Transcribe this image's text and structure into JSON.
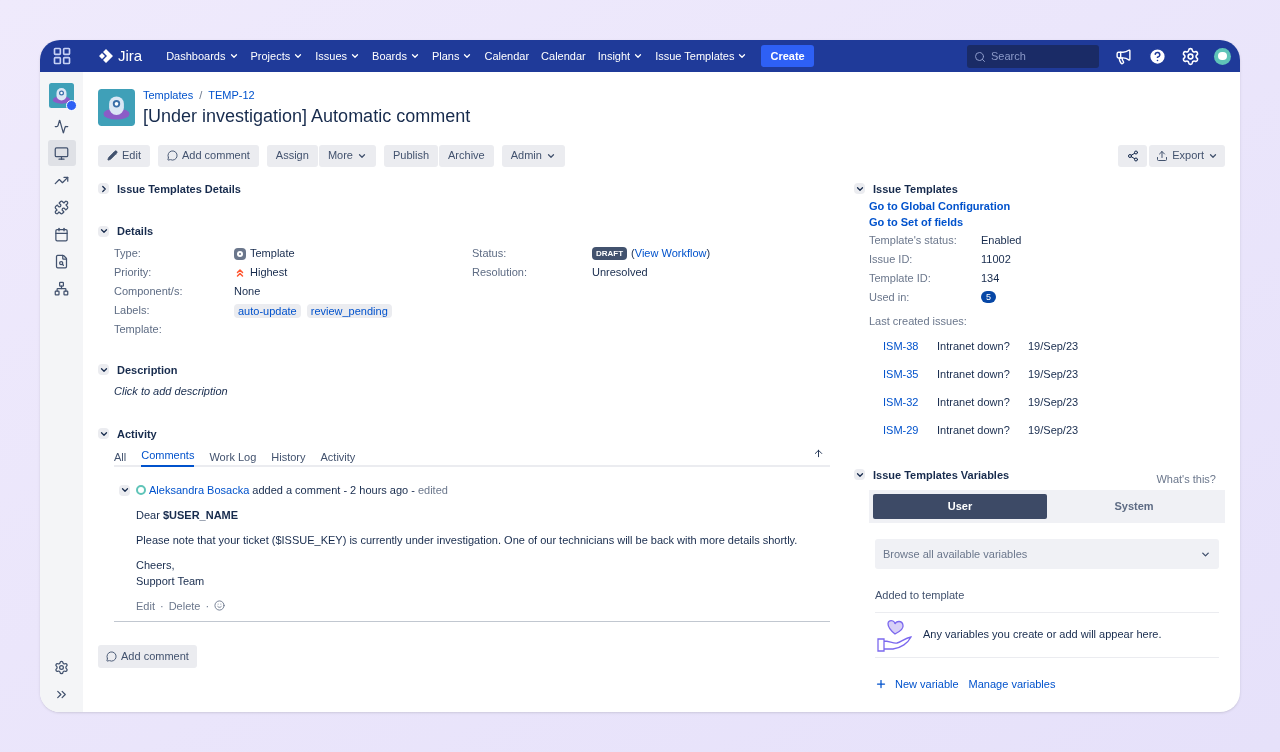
{
  "nav": {
    "logo": "Jira",
    "items": [
      {
        "label": "Dashboards",
        "has_menu": true
      },
      {
        "label": "Projects",
        "has_menu": true
      },
      {
        "label": "Issues",
        "has_menu": true
      },
      {
        "label": "Boards",
        "has_menu": true
      },
      {
        "label": "Plans",
        "has_menu": true
      },
      {
        "label": "Calendar",
        "has_menu": false
      },
      {
        "label": "Calendar",
        "has_menu": false
      },
      {
        "label": "Insight",
        "has_menu": true
      },
      {
        "label": "Issue Templates",
        "has_menu": true
      }
    ],
    "create": "Create",
    "search": {
      "placeholder": "Search"
    }
  },
  "sidebar": {
    "items": [
      {
        "selected": false
      },
      {
        "selected": true
      },
      {
        "selected": false
      },
      {
        "selected": false
      },
      {
        "selected": false
      },
      {
        "selected": false
      },
      {
        "selected": false
      }
    ]
  },
  "breadcrumbs": [
    {
      "label": "Templates",
      "kind": "link"
    },
    {
      "label": "/",
      "kind": "separator"
    },
    {
      "label": "TEMP-12",
      "kind": "link"
    }
  ],
  "title": "[Under investigation] Automatic comment",
  "toolbar": [
    [
      {
        "label": "Edit",
        "kind": "edit",
        "has_menu": false
      }
    ],
    [
      {
        "label": "Add comment",
        "kind": "comment",
        "has_menu": false
      }
    ],
    [
      {
        "label": "Assign",
        "kind": "plain",
        "has_menu": false
      },
      {
        "label": "More",
        "kind": "plain",
        "has_menu": true
      }
    ],
    [
      {
        "label": "Publish",
        "kind": "plain",
        "has_menu": false
      },
      {
        "label": "Archive",
        "kind": "plain",
        "has_menu": false
      }
    ],
    [
      {
        "label": "Admin",
        "kind": "plain",
        "has_menu": true
      }
    ]
  ],
  "export": "Export",
  "sections": {
    "templates_details": {
      "title": "Issue Templates Details",
      "expanded": false
    },
    "details": {
      "title": "Details",
      "expanded": true,
      "left": [
        {
          "label": "Type:",
          "value": "Template",
          "kind": "type"
        },
        {
          "label": "Priority:",
          "value": "Highest",
          "kind": "priority"
        },
        {
          "label": "Component/s:",
          "value": "None",
          "kind": "text"
        },
        {
          "label": "Labels:",
          "labels": [
            "auto-update",
            "review_pending"
          ],
          "kind": "labels"
        },
        {
          "label": "Template:",
          "kind": "empty"
        }
      ],
      "right": [
        {
          "label": "Status:",
          "badge": "DRAFT",
          "paren_open": "(",
          "link": "View Workflow",
          "paren_close": ")",
          "kind": "status"
        },
        {
          "label": "Resolution:",
          "value": "Unresolved",
          "kind": "text"
        }
      ]
    },
    "description": {
      "title": "Description",
      "expanded": true,
      "placeholder": "Click to add description"
    },
    "activity": {
      "title": "Activity",
      "expanded": true,
      "tabs": [
        {
          "label": "All",
          "selected": false
        },
        {
          "label": "Comments",
          "selected": true
        },
        {
          "label": "Work Log",
          "selected": false
        },
        {
          "label": "History",
          "selected": false
        },
        {
          "label": "Activity",
          "selected": false
        }
      ],
      "comment": {
        "expanded": true,
        "author": "Aleksandra Bosacka",
        "action": "added a comment - 2 hours ago -",
        "edited": "edited",
        "body": [
          "Dear **$USER_NAME**",
          "Please note that your ticket ($ISSUE_KEY) is currently under investigation. One of our technicians will be back with more details shortly.",
          "Cheers,\nSupport Team"
        ],
        "actions": [
          "Edit",
          "Delete"
        ],
        "separator": "·"
      },
      "add_comment": "Add comment"
    }
  },
  "issue_templates": {
    "title": "Issue Templates",
    "expanded": true,
    "links": [
      "Go to Global Configuration",
      "Go to Set of fields"
    ],
    "fields": [
      {
        "label": "Template's status:",
        "value": "Enabled",
        "kind": "text"
      },
      {
        "label": "Issue ID:",
        "value": "11002",
        "kind": "text"
      },
      {
        "label": "Template ID:",
        "value": "134",
        "kind": "text"
      },
      {
        "label": "Used in:",
        "value": "5",
        "kind": "count"
      }
    ],
    "last_label": "Last created issues:",
    "last_issues": [
      {
        "key": "ISM-38",
        "summary": "Intranet down?",
        "date": "19/Sep/23"
      },
      {
        "key": "ISM-35",
        "summary": "Intranet down?",
        "date": "19/Sep/23"
      },
      {
        "key": "ISM-32",
        "summary": "Intranet down?",
        "date": "19/Sep/23"
      },
      {
        "key": "ISM-29",
        "summary": "Intranet down?",
        "date": "19/Sep/23"
      }
    ]
  },
  "variables": {
    "title": "Issue Templates Variables",
    "expanded": true,
    "help": "What's this?",
    "tabs": [
      {
        "label": "User",
        "selected": true
      },
      {
        "label": "System",
        "selected": false
      }
    ],
    "browse": {
      "placeholder": "Browse all available variables"
    },
    "added_label": "Added to template",
    "empty": "Any variables you create or add will appear here.",
    "actions": [
      "New variable",
      "Manage variables"
    ]
  }
}
